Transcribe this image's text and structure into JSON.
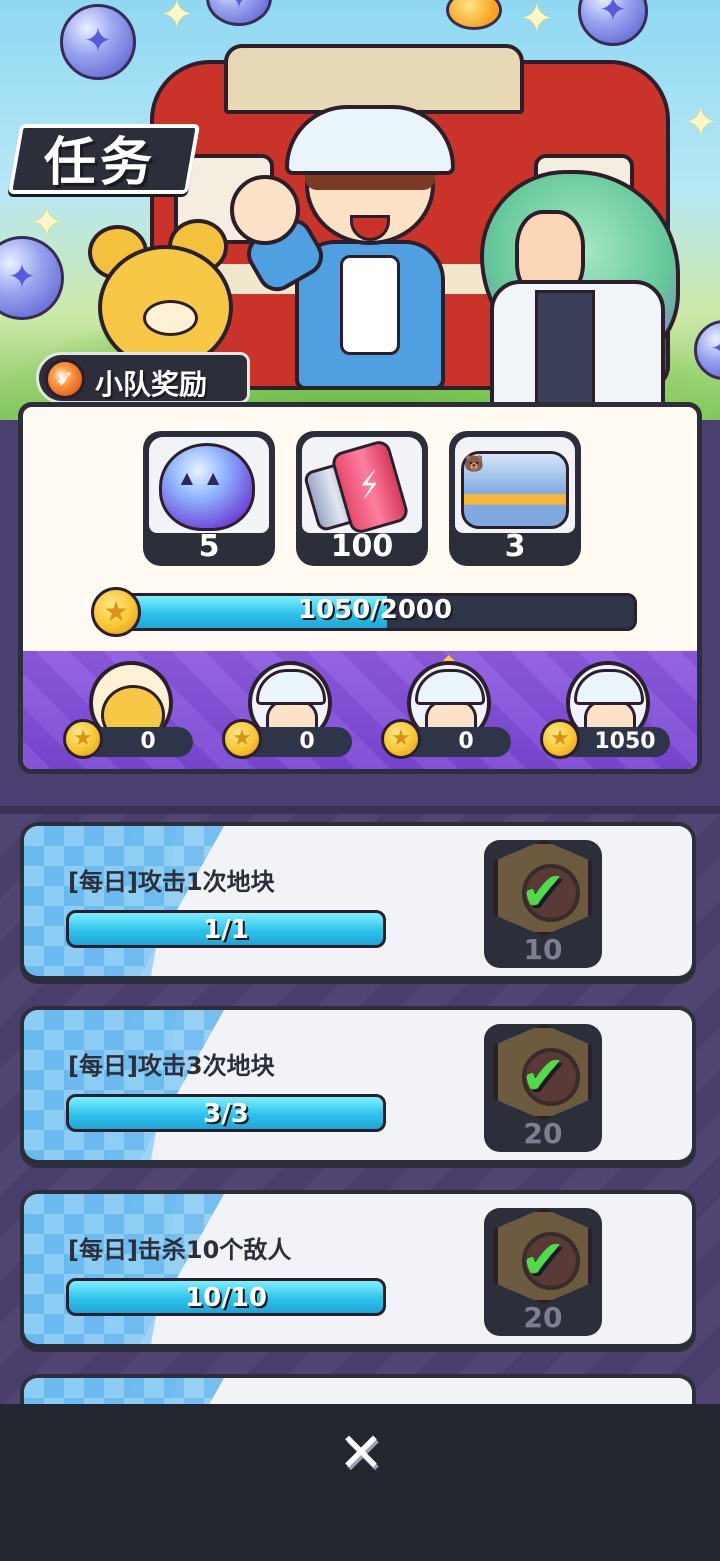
{
  "title": "任务",
  "team_rewards": {
    "label": "小队奖励",
    "items": [
      {
        "icon": "egg-capsule-icon",
        "count": "5"
      },
      {
        "icon": "energy-can-icon",
        "count": "100"
      },
      {
        "icon": "lunch-box-icon",
        "count": "3"
      }
    ],
    "points": {
      "current": 1050,
      "max": 2000,
      "text": "1050/2000",
      "progress": 0.525
    },
    "members": [
      {
        "avatar": "dog-avatar",
        "points": "0",
        "leader": false
      },
      {
        "avatar": "boy-avatar",
        "points": "0",
        "leader": false
      },
      {
        "avatar": "boy-avatar",
        "points": "0",
        "leader": true
      },
      {
        "avatar": "boy-avatar",
        "points": "1050",
        "leader": false
      }
    ]
  },
  "tasks": [
    {
      "title": "[每日]攻击1次地块",
      "progress_text": "1/1",
      "progress": 1.0,
      "reward": "10",
      "status": "completed"
    },
    {
      "title": "[每日]攻击3次地块",
      "progress_text": "3/3",
      "progress": 1.0,
      "reward": "20",
      "status": "completed"
    },
    {
      "title": "[每日]击杀10个敌人",
      "progress_text": "10/10",
      "progress": 1.0,
      "reward": "20",
      "status": "completed"
    }
  ],
  "close_icon": "close-icon",
  "colors": {
    "accent_cyan": "#2fc2ea",
    "purple": "#7a46d4",
    "check_green": "#4fdb4a",
    "dark": "#2c2f3a"
  }
}
